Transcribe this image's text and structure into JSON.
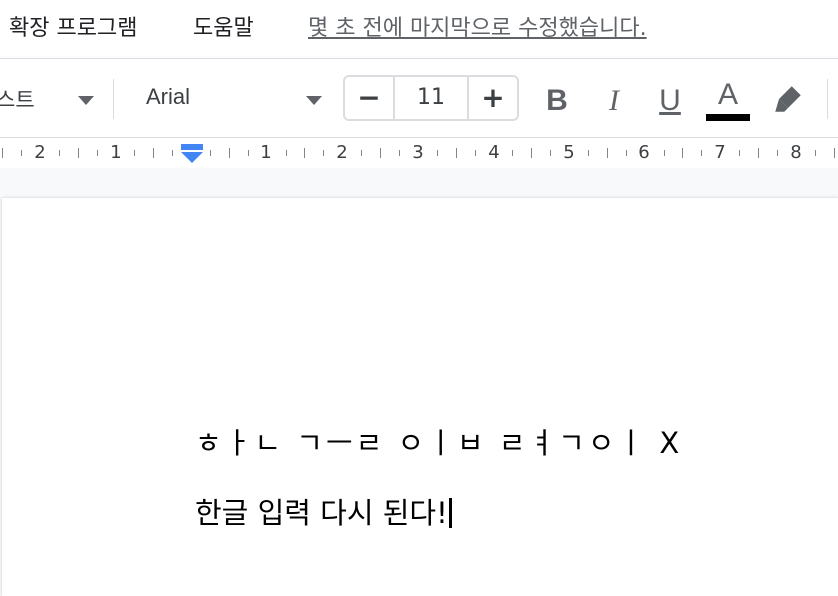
{
  "menu": {
    "items": [
      "확장 프로그램",
      "도움말"
    ],
    "last_edit": "몇 초 전에 마지막으로 수정했습니다."
  },
  "toolbar": {
    "paragraph_style": "스트",
    "font": "Arial",
    "font_size": "11",
    "decrease": "−",
    "increase": "+",
    "bold": "B",
    "italic": "I",
    "underline": "U",
    "text_color": "A",
    "text_color_value": "#000000"
  },
  "ruler": {
    "labels": [
      "2",
      "1",
      "1",
      "2",
      "3",
      "4",
      "5",
      "6",
      "7",
      "8"
    ],
    "accent": "#4285f4"
  },
  "document": {
    "line1": "ㅎㅏㄴ ㄱㅡㄹ ㅇㅣㅂ ㄹㅕㄱㅇㅣ X",
    "line2": "한글 입력 다시 된다!"
  }
}
